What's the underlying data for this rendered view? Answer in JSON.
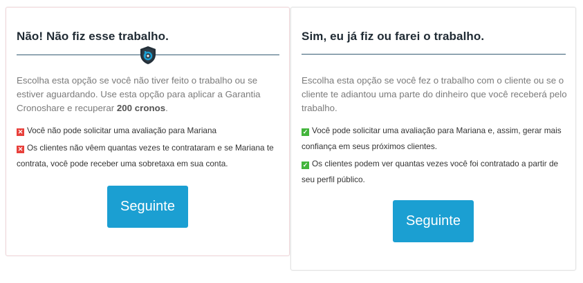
{
  "left_card": {
    "title": "Não! Não fiz esse trabalho.",
    "desc_pre": "Escolha esta opção se você não tiver feito o trabalho ou se estiver aguardando. Use esta opção para aplicar a Garantia Cronoshare e recuperar ",
    "desc_bold": "200 cronos",
    "desc_post": ".",
    "items": [
      {
        "icon": "x-mark-icon",
        "text": "Você não pode solicitar uma avaliação para Mariana"
      },
      {
        "icon": "x-mark-icon",
        "text": "Os clientes não vêem quantas vezes te contrataram e se Mariana te contrata, você pode receber uma sobretaxa em sua conta."
      }
    ],
    "button_label": "Seguinte"
  },
  "right_card": {
    "title": "Sim, eu já fiz ou farei o trabalho.",
    "desc": "Escolha esta opção se você fez o trabalho com o cliente ou se o cliente te adiantou uma parte do dinheiro que você receberá pelo trabalho.",
    "items": [
      {
        "icon": "check-mark-icon",
        "text": "Você pode solicitar uma avaliação para Mariana e, assim, gerar mais confiança em seus próximos clientes."
      },
      {
        "icon": "check-mark-icon",
        "text": "Os clientes podem ver quantas vezes você foi contratado a partir de seu perfil público."
      }
    ],
    "button_label": "Seguinte"
  },
  "colors": {
    "accent": "#1b9fd2",
    "divider": "#345b72",
    "x_mark": "#e8403b",
    "check_mark": "#43b53c"
  }
}
